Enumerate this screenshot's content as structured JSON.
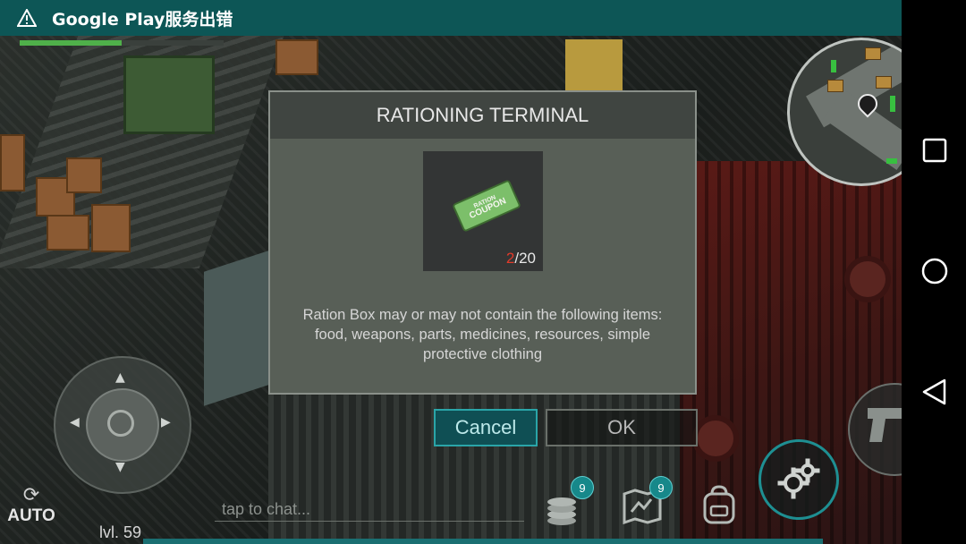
{
  "status_bar": {
    "notification_text": "Google Play服务出错",
    "background_color": "#0d5656"
  },
  "player": {
    "health_fraction": 0.5,
    "level_label": "lvl. 59"
  },
  "dialog": {
    "title": "RATIONING TERMINAL",
    "item": {
      "name_line1": "RATION",
      "name_line2": "COUPON",
      "count_current": "2",
      "count_separator": "/",
      "count_max": "20"
    },
    "description": "Ration Box may or may not contain the following items: food, weapons, parts, medicines, resources, simple protective clothing",
    "cancel_label": "Cancel",
    "ok_label": "OK"
  },
  "controls": {
    "auto_label": "AUTO",
    "chat_placeholder": "tap to chat...",
    "resources_badge": "9",
    "map_badge": "9"
  },
  "icons": {
    "warning": "warning-icon",
    "auto": "refresh-icon",
    "resources": "coins-stack-icon",
    "map": "map-icon",
    "backpack": "backpack-icon",
    "settings": "gears-icon",
    "gun": "pistol-icon",
    "nav_recents": "square-icon",
    "nav_home": "circle-icon",
    "nav_back": "triangle-back-icon"
  },
  "colors": {
    "accent_teal": "#1e8f92",
    "count_red": "#e23a2a",
    "health_green": "#4fb04a"
  }
}
